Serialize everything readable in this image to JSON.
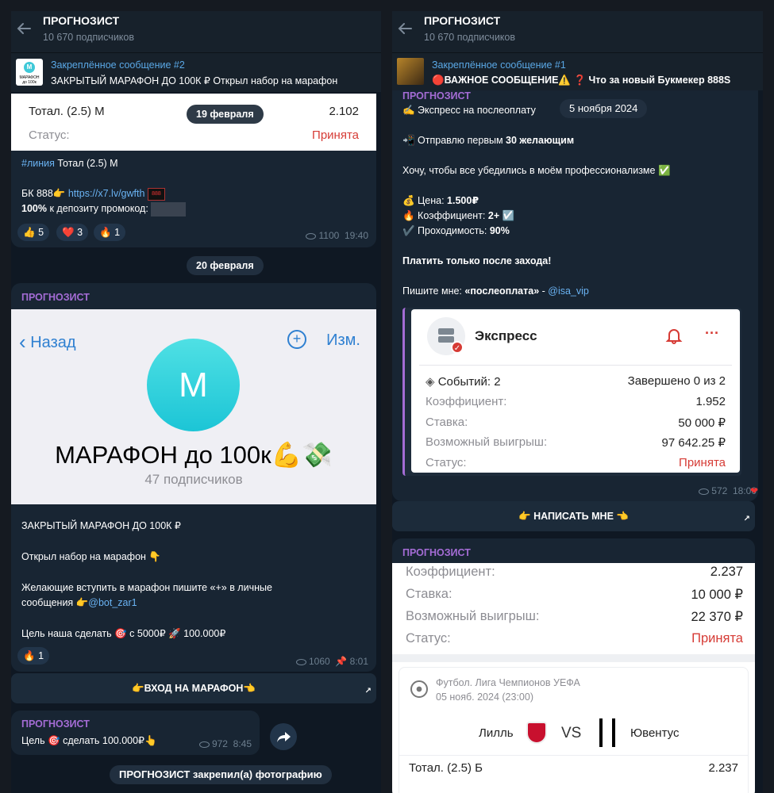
{
  "left": {
    "header": {
      "title": "ПРОГНОЗИСТ",
      "subscribers": "10 670 подписчиков"
    },
    "pinned": {
      "label": "Закреплённое сообщение #2",
      "text": "ЗАКРЫТЫЙ МАРАФОН ДО 100К ₽  Открыл набор на марафон",
      "thumb_letter": "M",
      "thumb_text": "МАРАФОН до 100к"
    },
    "bet_card": {
      "title": "Тотал. (2.5) М",
      "odds": "2.102",
      "date_chip": "19 февраля",
      "status_label": "Статус:",
      "status_value": "Принята"
    },
    "msg1": {
      "hashtag": "#линия",
      "line1_rest": " Тотал (2.5) М",
      "bk_text": "БК 888👉 ",
      "bk_link": "https://x7.lv/gwfth",
      "bonus_bold": "100%",
      "bonus_text": " к депозиту промокод:",
      "reactions": [
        {
          "emoji": "👍",
          "count": "5"
        },
        {
          "emoji": "❤️",
          "count": "3"
        },
        {
          "emoji": "🔥",
          "count": "1"
        }
      ],
      "views": "1100",
      "time": "19:40"
    },
    "date_chip_2": "20 февраля",
    "msg2": {
      "author": "ПРОГНОЗИСТ",
      "screen": {
        "back": "Назад",
        "edit": "Изм.",
        "avatar_letter": "M",
        "channel_name": "МАРАФОН до 100к💪💸",
        "channel_subs": "47 подписчиков"
      },
      "p1": "ЗАКРЫТЫЙ МАРАФОН ДО 100К ₽",
      "p2": "Открыл набор на марафон 👇",
      "p3a": "Желающие вступить в марафон пишите «+» в личные",
      "p3b_text": "сообщения 👉",
      "p3b_link": "@bot_zar1",
      "p4": "Цель наша сделать 🎯 с 5000₽ 🚀 100.000₽",
      "reactions": [
        {
          "emoji": "🔥",
          "count": "1"
        }
      ],
      "views": "1060",
      "time": "8:01"
    },
    "button_marathon": "👉ВХОД НА МАРАФОН👈",
    "msg3": {
      "author": "ПРОГНОЗИСТ",
      "text": "Цель 🎯 сделать 100.000₽👆",
      "views": "972",
      "time": "8:45"
    },
    "service": "ПРОГНОЗИСТ закрепил(а) фотографию"
  },
  "right": {
    "header": {
      "title": "ПРОГНОЗИСТ",
      "subscribers": "10 670 подписчиков"
    },
    "pinned": {
      "label": "Закреплённое сообщение #1",
      "text": "🔴ВАЖНОЕ СООБЩЕНИЕ⚠️  ❓ Что за новый Букмекер 888S"
    },
    "msg1": {
      "author": "ПРОГНОЗИСТ",
      "line1": "✍️ Экспресс на послеоплату",
      "date_chip": "5 ноября 2024",
      "line2a": "📲 Отправлю первым ",
      "line2b": "30 желающим",
      "line3": "Хочу, чтобы все убедились в моём профессионализме ✅",
      "price_label": "💰 Цена: ",
      "price_value": "1.500₽",
      "coef_label": "🔥 Коэффициент: ",
      "coef_value": "2+ ☑️",
      "pass_label": "✔️ Проходимость: ",
      "pass_value": "90%",
      "pay": "Платить только после захода!",
      "write_a": "Пишите мне: ",
      "write_b": "«послеоплата»",
      "write_c": " - ",
      "write_link": "@isa_vip",
      "card": {
        "title": "Экспресс",
        "events_label": "Событий: 2",
        "events_done": "Завершено 0 из 2",
        "rows": [
          {
            "label": "Коэффициент:",
            "value": "1.952"
          },
          {
            "label": "Ставка:",
            "value": "50 000 ₽"
          },
          {
            "label": "Возможный выигрыш:",
            "value": "97 642.25 ₽"
          }
        ],
        "status_label": "Статус:",
        "status_value": "Принята"
      },
      "views": "572",
      "time": "18:00"
    },
    "button_write": "👉 НАПИСАТЬ МНЕ 👈",
    "msg2": {
      "author": "ПРОГНОЗИСТ",
      "rows": [
        {
          "label": "Коэффициент:",
          "value": "2.237"
        },
        {
          "label": "Ставка:",
          "value": "10 000 ₽"
        },
        {
          "label": "Возможный выигрыш:",
          "value": "22 370 ₽"
        }
      ],
      "status_label": "Статус:",
      "status_value": "Принята",
      "match": {
        "league": "Футбол. Лига Чемпионов УЕФА",
        "date": "05 нояб. 2024 (23:00)",
        "team1": "Лилль",
        "vs": "VS",
        "team2": "Ювентус",
        "market": "Тотал. (2.5) Б",
        "odds": "2.237"
      }
    }
  },
  "colors": {
    "bg": "#0f1823",
    "bubble": "#182533",
    "author": "#a46cd5",
    "link": "#6ab3f3",
    "accepted": "#d63b35"
  }
}
